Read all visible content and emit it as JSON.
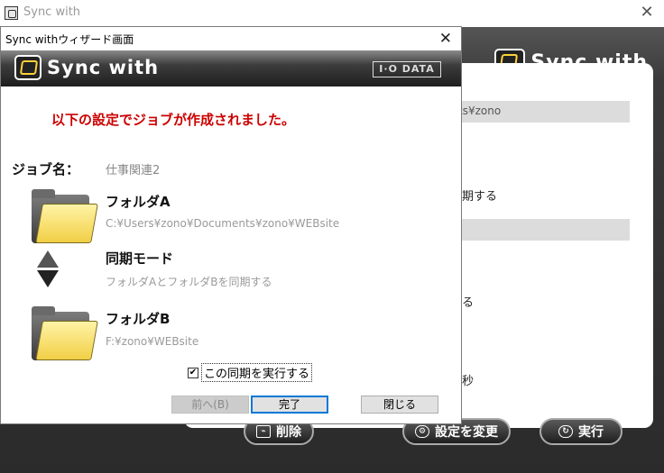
{
  "main_window": {
    "title": "Sync with",
    "logo_text": "Sync with",
    "fragments": {
      "path": "ts¥zono",
      "f1": "期する",
      "f2": "る",
      "f3": "秒"
    },
    "buttons": {
      "delete": "削除",
      "change_settings": "設定を変更",
      "execute": "実行"
    }
  },
  "wizard": {
    "title": "Sync withウィザード画面",
    "logo_text": "Sync with",
    "brand": "I·O DATA",
    "heading": "以下の設定でジョブが作成されました。",
    "job_name_label": "ジョブ名：",
    "job_name_value": "仕事関連2",
    "folder_a": {
      "title": "フォルダA",
      "path": "C:¥Users¥zono¥Documents¥zono¥WEBsite"
    },
    "sync_mode": {
      "title": "同期モード",
      "description": "フォルダAとフォルダBを同期する"
    },
    "folder_b": {
      "title": "フォルダB",
      "path": "F:¥zono¥WEBsite"
    },
    "run_checkbox": {
      "label": "この同期を実行する",
      "checked": true
    },
    "buttons": {
      "back": "前へ(B)",
      "finish": "完了",
      "close": "閉じる"
    }
  }
}
